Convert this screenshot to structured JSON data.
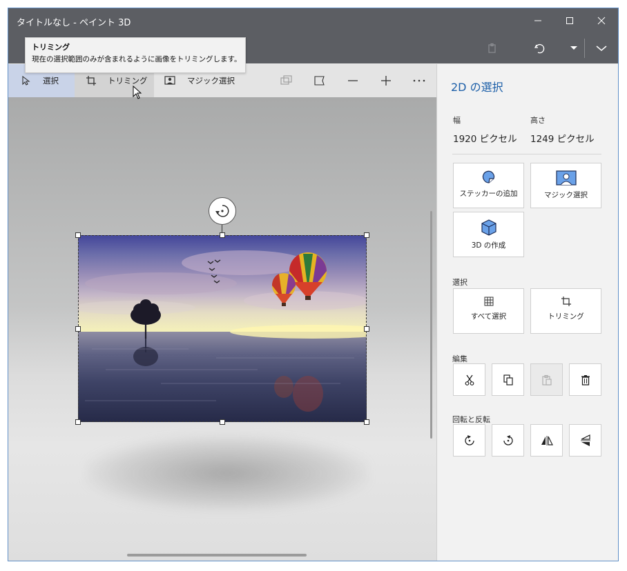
{
  "window": {
    "title": "タイトルなし - ペイント 3D"
  },
  "tooltip": {
    "title": "トリミング",
    "description": "現在の選択範囲のみが含まれるように画像をトリミングします。"
  },
  "toolbar": {
    "select_label": "選択",
    "crop_label": "トリミング",
    "magic_select_label": "マジック選択"
  },
  "panel": {
    "title": "2D の選択",
    "width_label": "幅",
    "width_value": "1920 ピクセル",
    "height_label": "高さ",
    "height_value": "1249 ピクセル",
    "add_sticker_label": "ステッカーの追加",
    "magic_select_label": "マジック選択",
    "make_3d_label": "3D の作成",
    "select_section": "選択",
    "select_all_label": "すべて選択",
    "crop_label": "トリミング",
    "edit_section": "編集",
    "rotate_flip_section": "回転と反転"
  },
  "colors": {
    "accent": "#1b5ea8",
    "titlebar": "#5c5e63",
    "select_highlight": "#c9d3e8"
  }
}
